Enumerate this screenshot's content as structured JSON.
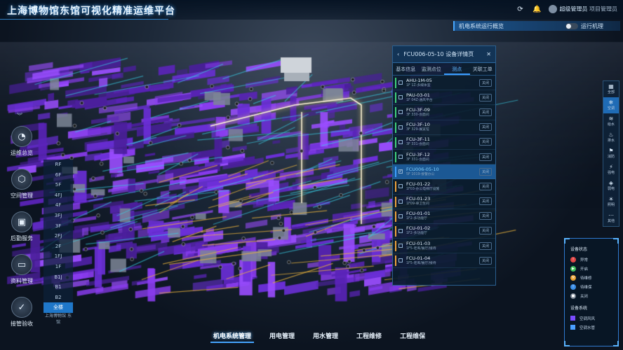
{
  "header": {
    "title": "上海博物馆东馆可视化精准运维平台",
    "user_label": "超级管理员",
    "user_sub": "项目管理员"
  },
  "overview": {
    "title": "机电系统运行概览",
    "right_label": "运行机理"
  },
  "left_nav": [
    {
      "label": "运维总览",
      "icon": "gauge-icon",
      "glyph": "◔"
    },
    {
      "label": "空间管理",
      "icon": "cube-icon",
      "glyph": "⬡"
    },
    {
      "label": "后勤服务",
      "icon": "monitor-icon",
      "glyph": "▣"
    },
    {
      "label": "资料管理",
      "icon": "folder-icon",
      "glyph": "▭"
    },
    {
      "label": "接管验收",
      "icon": "clipboard-icon",
      "glyph": "✓"
    }
  ],
  "floors": [
    "RF",
    "6F",
    "5F",
    "4FJ",
    "4F",
    "3FJ",
    "3F",
    "2FJ",
    "2F",
    "1FJ",
    "1F",
    "B1J",
    "B1",
    "B2",
    "全楼"
  ],
  "active_floor": "全楼",
  "building_label": "上海博物馆 东馆",
  "device_panel": {
    "title": "FCU006-05-10 设备详情页",
    "tabs": [
      "基本信息",
      "监测点位",
      "测点",
      "关联工单"
    ],
    "active_tab": "测点",
    "devices": [
      {
        "name": "AHU-1M-05",
        "loc": "1F 1Z-多媒体室",
        "status": "关闭",
        "color": "#3fd27a"
      },
      {
        "name": "PAU-03-01",
        "loc": "1F 04Z-通风平台",
        "status": "关闭",
        "color": "#3fd27a"
      },
      {
        "name": "FCU-3F-09",
        "loc": "3F 330-会面间",
        "status": "关闭",
        "color": "#3fd27a"
      },
      {
        "name": "FCU-3F-10",
        "loc": "3F 329-展览馆",
        "status": "关闭",
        "color": "#3fd27a"
      },
      {
        "name": "FCU-3F-11",
        "loc": "3F 331-会面间",
        "status": "关闭",
        "color": "#3fd27a"
      },
      {
        "name": "FCU-3F-12",
        "loc": "3F 331-会面间",
        "status": "关闭",
        "color": "#3fd27a"
      },
      {
        "name": "FCU006-05-10",
        "loc": "5F 1019-接警办公",
        "status": "关闭",
        "color": "#3fa0ff",
        "selected": true
      },
      {
        "name": "FCU-01-22",
        "loc": "1F03-办公电梯厅设施",
        "status": "关闭",
        "color": "#f0a23a"
      },
      {
        "name": "FCU-01-23",
        "loc": "1F09-单卫生间",
        "status": "关闭",
        "color": "#f0a23a"
      },
      {
        "name": "FCU-01-01",
        "loc": "1F2-多功能厅",
        "status": "关闭",
        "color": "#f0a23a"
      },
      {
        "name": "FCU-01-02",
        "loc": "1F2-多功能厅",
        "status": "关闭",
        "color": "#f0a23a"
      },
      {
        "name": "FCU-01-03",
        "loc": "1F5-老库/展厅/接待",
        "status": "关闭",
        "color": "#f0a23a"
      },
      {
        "name": "FCU-01-04",
        "loc": "1F5-老库/展厅/接待",
        "status": "关闭",
        "color": "#f0a23a"
      }
    ]
  },
  "right_toolbar": [
    {
      "label": "全部",
      "glyph": "▦"
    },
    {
      "label": "空调",
      "glyph": "❄",
      "active": true
    },
    {
      "label": "给水",
      "glyph": "≋"
    },
    {
      "label": "排水",
      "glyph": "♨"
    },
    {
      "label": "消防",
      "glyph": "⚑"
    },
    {
      "label": "强电",
      "glyph": "⚡"
    },
    {
      "label": "弱电",
      "glyph": "◈"
    },
    {
      "label": "照明",
      "glyph": "☀"
    },
    {
      "label": "其他",
      "glyph": "⋯"
    }
  ],
  "legend": {
    "status_title": "设备状态",
    "status": [
      {
        "label": "异常",
        "color": "#e04545",
        "glyph": "!"
      },
      {
        "label": "开启",
        "color": "#3fbf5a",
        "glyph": "▶"
      },
      {
        "label": "待维修",
        "color": "#e8a030",
        "glyph": "⚒"
      },
      {
        "label": "待维保",
        "color": "#3b8fe8",
        "glyph": "!"
      },
      {
        "label": "关闭",
        "color": "#7b8593",
        "glyph": "■"
      }
    ],
    "system_title": "设备系统",
    "systems": [
      {
        "label": "空调风风",
        "color": "#7a4cff"
      },
      {
        "label": "空调水管",
        "color": "#4aa0ff"
      }
    ]
  },
  "bottom_nav": [
    {
      "label": "机电系统管理",
      "active": true
    },
    {
      "label": "用电管理"
    },
    {
      "label": "用水管理"
    },
    {
      "label": "工程维修"
    },
    {
      "label": "工程维保"
    }
  ]
}
